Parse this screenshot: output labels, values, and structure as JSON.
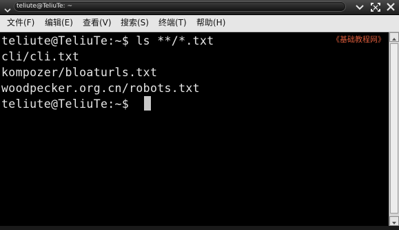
{
  "window": {
    "title": "teliute@TeliuTe: ~",
    "controls": [
      "minimize-icon",
      "maximize-icon",
      "close-icon"
    ]
  },
  "menubar": {
    "items": [
      {
        "label": "文件(F)"
      },
      {
        "label": "编辑(E)"
      },
      {
        "label": "查看(V)"
      },
      {
        "label": "搜索(S)"
      },
      {
        "label": "终端(T)"
      },
      {
        "label": "帮助(H)"
      }
    ]
  },
  "terminal": {
    "lines": [
      "teliute@TeliuTe:~$ ls **/*.txt",
      "cli/cli.txt",
      "kompozer/bloaturls.txt",
      "woodpecker.org.cn/robots.txt",
      "teliute@TeliuTe:~$ "
    ],
    "watermark": "《基础教程网》"
  },
  "colors": {
    "terminal_bg": "#000000",
    "terminal_fg": "#e6e6e6",
    "watermark": "#d85a3a",
    "menubar_bg": "#e6e6e6"
  }
}
